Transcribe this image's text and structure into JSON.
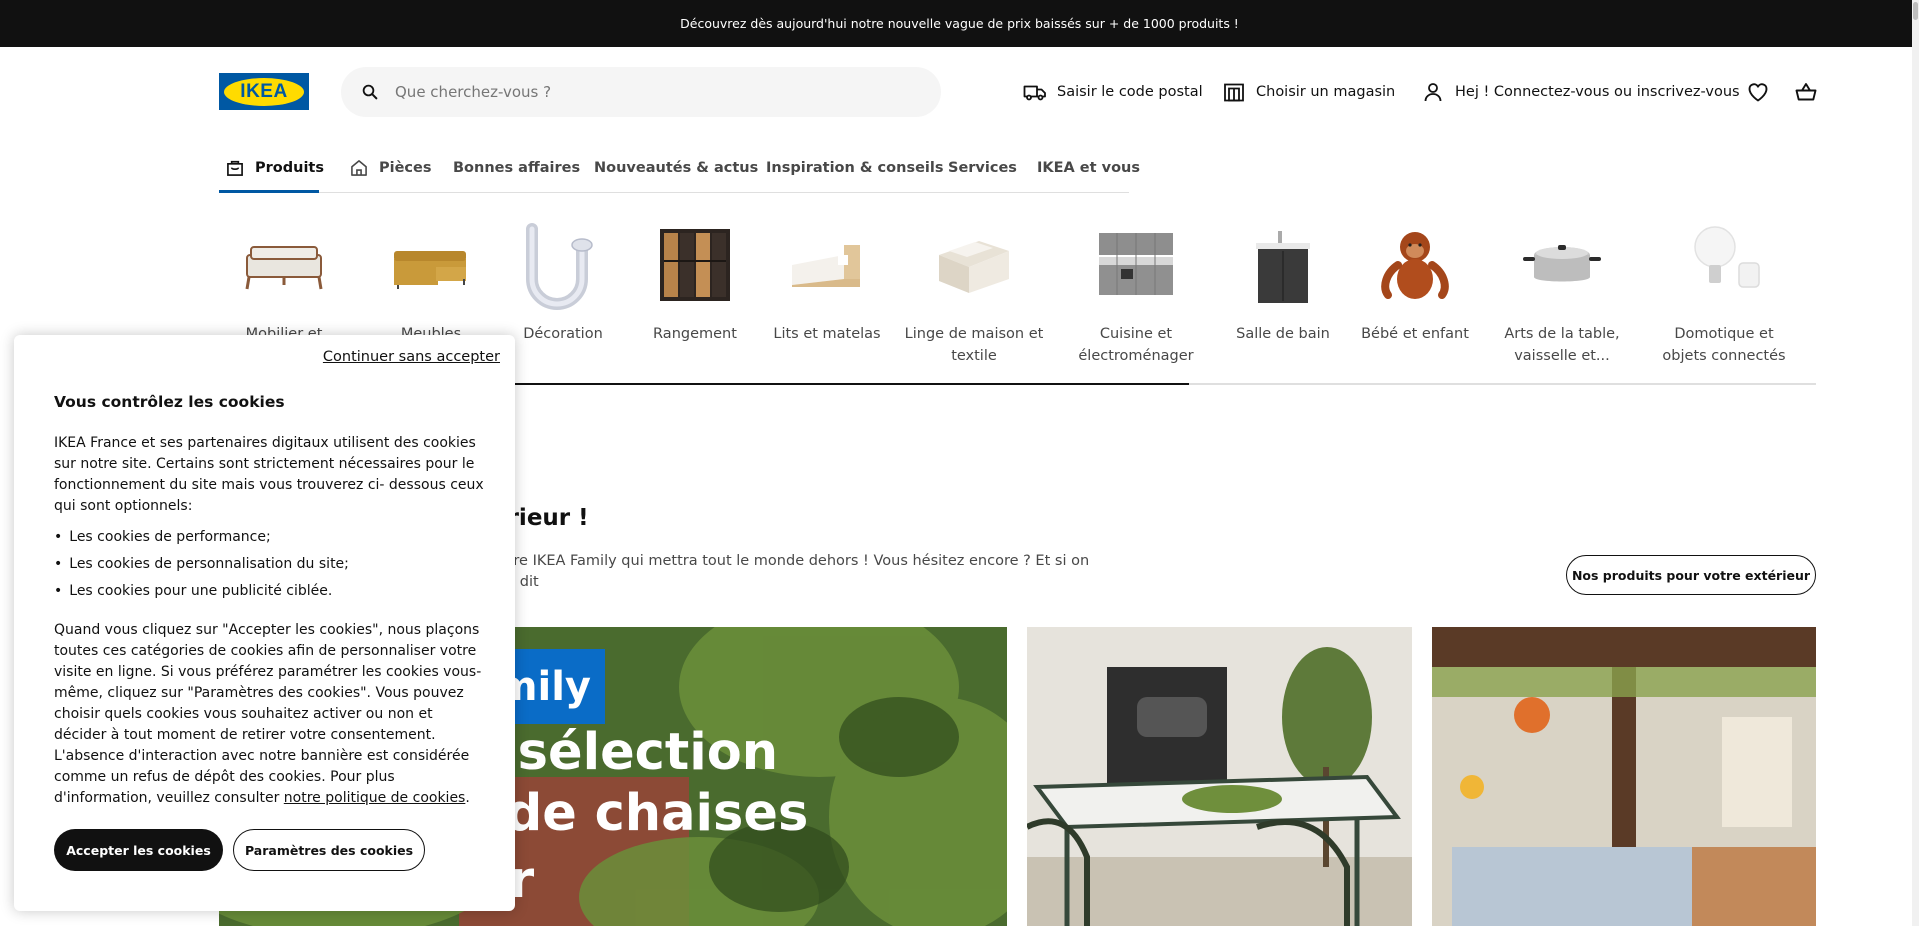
{
  "promo": {
    "text": "Découvrez dès aujourd'hui notre nouvelle vague de prix baissés sur + de 1000 produits !"
  },
  "header": {
    "logo": "IKEA",
    "search_placeholder": "Que cherchez-vous ?",
    "postal": "Saisir le code postal",
    "store": "Choisir un magasin",
    "login": "Hej ! Connectez-vous ou inscrivez-vous",
    "icons": {
      "search": "search-icon",
      "truck": "truck-icon",
      "store": "store-icon",
      "user": "user-icon",
      "favorites": "heart-icon",
      "cart": "cart-icon"
    }
  },
  "nav": {
    "items": [
      {
        "label": "Produits",
        "icon": "shopping-bag-icon",
        "active": true
      },
      {
        "label": "Pièces",
        "icon": "home-icon"
      },
      {
        "label": "Bonnes affaires"
      },
      {
        "label": "Nouveautés & actus"
      },
      {
        "label": "Inspiration & conseils"
      },
      {
        "label": "Services"
      },
      {
        "label": "IKEA et vous"
      }
    ]
  },
  "categories": [
    {
      "label": "Mobilier et"
    },
    {
      "label": "Meubles"
    },
    {
      "label": "Décoration"
    },
    {
      "label": "Rangement"
    },
    {
      "label": "Lits et matelas"
    },
    {
      "label": "Linge de maison et textile"
    },
    {
      "label": "Cuisine et électroménager"
    },
    {
      "label": "Salle de bain"
    },
    {
      "label": "Bébé et enfant"
    },
    {
      "label": "Arts de la table, vaisselle et..."
    },
    {
      "label": "Domotique et objets connectés"
    }
  ],
  "section": {
    "title": "térieur !",
    "desc_line1": "e offre IKEA Family qui mettra tout le monde dehors ! Vous hésitez encore ?  Et si on vous dit",
    "desc_line2": "?",
    "button": "Nos produits pour votre extérieur"
  },
  "hero": {
    "badge": "mily",
    "line1": "ne sélection",
    "line2": "et de chaises",
    "line3": "r"
  },
  "cookie": {
    "continue": "Continuer sans accepter",
    "title": "Vous contrôlez les cookies",
    "intro": "IKEA France et ses partenaires digitaux utilisent des cookies sur notre site. Certains sont strictement nécessaires pour le fonctionnement du site mais vous trouverez ci- dessous ceux qui sont optionnels:",
    "list": [
      "Les cookies de performance;",
      "Les cookies de personnalisation du site;",
      "Les cookies pour une publicité ciblée."
    ],
    "body": "Quand vous cliquez sur \"Accepter les cookies\", nous plaçons toutes ces catégories de cookies afin de personnaliser votre visite en ligne. Si vous préférez paramétrer les cookies vous-même, cliquez sur \"Paramètres des cookies\". Vous pouvez choisir quels cookies vous souhaitez activer ou non et décider à tout moment de retirer votre consentement. L'absence d'interaction avec notre bannière est considérée comme un refus de dépôt des cookies. Pour plus d'information, veuillez consulter",
    "policy_link": "notre politique de cookies",
    "period": ".",
    "accept": "Accepter les cookies",
    "settings": "Paramètres des cookies"
  },
  "colors": {
    "brand_blue": "#0058a3",
    "brand_yellow": "#ffdb00",
    "promo_bg": "#111111",
    "family_blue": "#0a6cc7"
  }
}
